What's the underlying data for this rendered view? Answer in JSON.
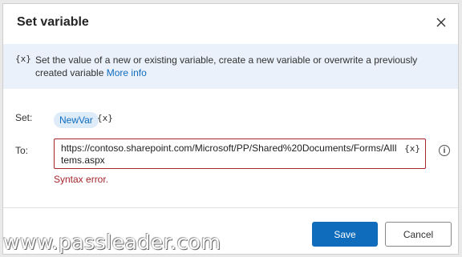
{
  "dialog": {
    "title": "Set variable",
    "close_icon": "close-icon"
  },
  "banner": {
    "icon_text": "{x}",
    "description": "Set the value of a new or existing variable, create a new variable or overwrite a previously created variable",
    "link_label": "More info"
  },
  "set_field": {
    "label": "Set:",
    "variable_name": "NewVar",
    "variable_button": "{x}"
  },
  "to_field": {
    "label": "To:",
    "value": "https://contoso.sharepoint.com/Microsoft/PP/Shared%20Documents/Forms/AllItems.aspx",
    "variable_button": "{x}",
    "error": "Syntax error."
  },
  "footer": {
    "save_label": "Save",
    "cancel_label": "Cancel"
  },
  "watermark": "www.passleader.com",
  "colors": {
    "accent": "#0f6cbd",
    "error": "#a4262c",
    "banner_bg": "#eaf1fb"
  }
}
